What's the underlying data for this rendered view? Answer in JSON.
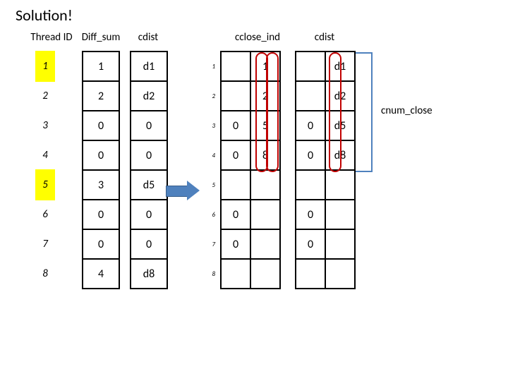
{
  "title": "Solution!",
  "headers": {
    "thread_id": "Thread ID",
    "diff_sum": "Diff_sum",
    "cdist1": "cdist",
    "cclose_ind": "cclose_ind",
    "cdist2": "cdist"
  },
  "thread_ids": [
    "1",
    "2",
    "3",
    "4",
    "5",
    "6",
    "7",
    "8"
  ],
  "diff_sum": [
    "1",
    "2",
    "0",
    "0",
    "3",
    "0",
    "0",
    "4"
  ],
  "cdist_a": [
    "d1",
    "d2",
    "0",
    "0",
    "d5",
    "0",
    "0",
    "d8"
  ],
  "row_nums": [
    "1",
    "2",
    "3",
    "4",
    "5",
    "6",
    "7",
    "8"
  ],
  "cclose_a": [
    "",
    "",
    "0",
    "0",
    "",
    "0",
    "0",
    ""
  ],
  "cclose_b": [
    "1",
    "2",
    "5",
    "8",
    "",
    "",
    "",
    ""
  ],
  "cdist_b_a": [
    "",
    "",
    "0",
    "0",
    "",
    "0",
    "0",
    ""
  ],
  "cdist_b_b": [
    "d1",
    "d2",
    "d5",
    "d8",
    "",
    "",
    "",
    ""
  ],
  "cnum_close_label": "cnum_close",
  "thread_highlight": [
    true,
    false,
    false,
    false,
    true,
    false,
    false,
    false
  ]
}
